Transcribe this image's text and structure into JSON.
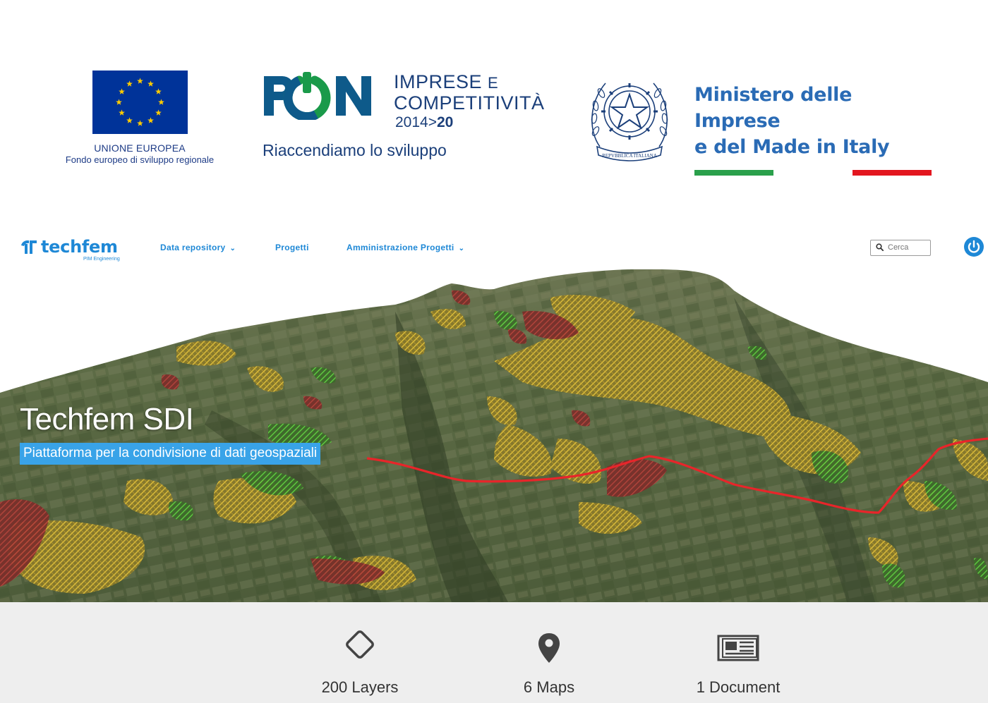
{
  "banner": {
    "eu": {
      "line1": "UNIONE EUROPEA",
      "line2": "Fondo europeo di sviluppo regionale"
    },
    "pon": {
      "brand": "PON",
      "line1a": "IMPRESE",
      "line1b": "E",
      "line2": "COMPETITIVITÀ",
      "year_start": "2014",
      "year_sep": ">",
      "year_end": "20",
      "slogan": "Riaccendiamo lo sviluppo"
    },
    "emblem": {
      "text": "REPVBBLICA ITALIANA"
    },
    "ministry": {
      "line1": "Ministero delle Imprese",
      "line2": "e del Made in Italy"
    },
    "colors": {
      "eu_blue": "#003399",
      "eu_gold": "#ffcc00",
      "pon_green": "#1a9a4a",
      "pon_blue": "#0e5a8a",
      "italy_green": "#2aa04b",
      "italy_red": "#e3161f"
    }
  },
  "navbar": {
    "logo": {
      "name": "techfem",
      "tagline": "PIM Engineering"
    },
    "items": [
      {
        "label": "Data repository",
        "has_dropdown": true
      },
      {
        "label": "Progetti",
        "has_dropdown": false
      },
      {
        "label": "Amministrazione Progetti",
        "has_dropdown": true
      }
    ],
    "search": {
      "placeholder": "Cerca",
      "icon": "search-icon"
    },
    "power_icon": "power-icon",
    "accent": "#1e88d6"
  },
  "hero": {
    "title": "Techfem SDI",
    "subtitle": "Piattaforma per la condivisione di dati geospaziali",
    "subtitle_bg": "#39a3e8"
  },
  "stats": [
    {
      "label": "200 Layers",
      "icon": "layers-diamond-icon"
    },
    {
      "label": "6 Maps",
      "icon": "map-pin-icon"
    },
    {
      "label": "1 Document",
      "icon": "document-newspaper-icon"
    }
  ]
}
